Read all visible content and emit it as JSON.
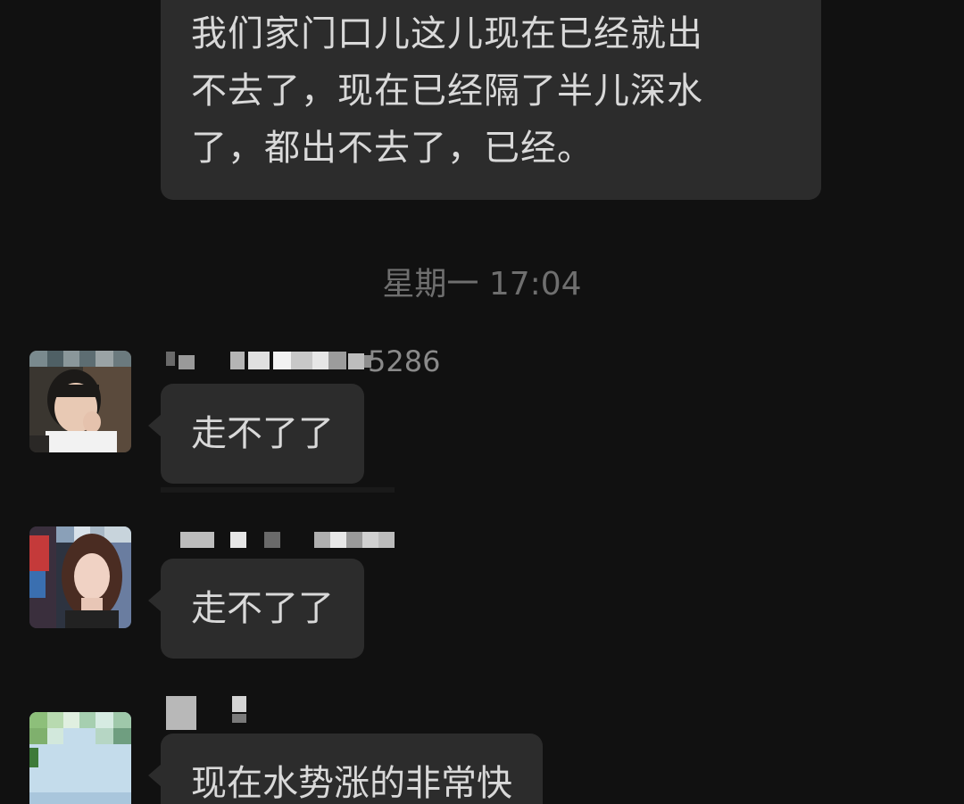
{
  "chat": {
    "top_message": {
      "lines": [
        "我们家门口儿这儿现在已经就出",
        "不去了，现在已经隔了半儿深水",
        "了，都出不去了，已经。"
      ]
    },
    "timestamp": "星期一 17:04",
    "messages": [
      {
        "sender_name_visible": "5286",
        "text": "走不了了",
        "avatar": "avatar-woman-short-hair"
      },
      {
        "sender_name_visible": "",
        "text": "走不了了",
        "avatar": "avatar-woman-long-hair"
      },
      {
        "sender_name_visible": "",
        "text": "现在水势涨的非常快",
        "avatar": "avatar-sky-landscape"
      }
    ]
  },
  "colors": {
    "background": "#111111",
    "bubble": "#2c2c2c",
    "text": "#d9d9d9",
    "timestamp": "#6f6f6f"
  }
}
